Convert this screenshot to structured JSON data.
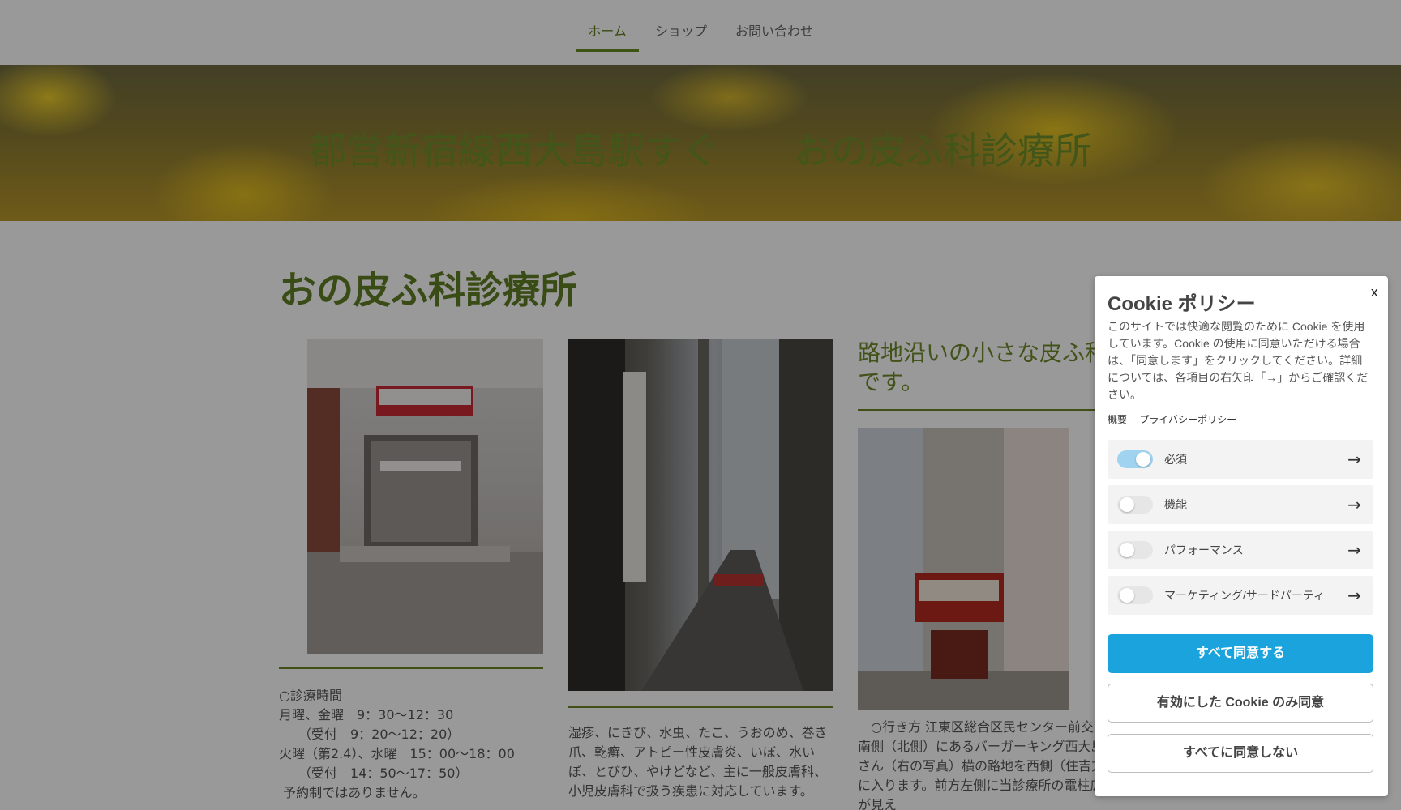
{
  "nav": {
    "items": [
      {
        "label": "ホーム",
        "active": true
      },
      {
        "label": "ショップ",
        "active": false
      },
      {
        "label": "お問い合わせ",
        "active": false
      }
    ]
  },
  "hero": {
    "title": "都営新宿線西大島駅すぐ　　おの皮ふ科診療所"
  },
  "main": {
    "page_title": "おの皮ふ科診療所",
    "tagline": "路地沿いの小さな皮ふ科です。",
    "hours": "○診療時間\n月曜、金曜　9：30～12：30\n　　（受付　9：20～12：20）\n火曜（第2.4）、水曜　15：00～18：00\n　　（受付　14：50～17：50）\n 予約制ではありません。",
    "symptoms": "湿疹、にきび、水虫、たこ、うおのめ、巻き爪、乾癬、アトピー性皮膚炎、いぼ、水いぼ、とびひ、やけどなど、主に一般皮膚科、小児皮膚科で扱う疾患に対応しています。",
    "access": "　○行き方\n江東区総合区民センター前交差点南側（北側）にあるバーガーキング西大島店さん（右の写真）横の路地を西側（住吉方面）に入ります。前方左側に当診療所の電柱広告が見え"
  },
  "cookie": {
    "title": "Cookie ポリシー",
    "close": "x",
    "description": "このサイトでは快適な閲覧のために Cookie を使用しています。Cookie の使用に同意いただける場合は、「同意します」をクリックしてください。詳細については、各項目の右矢印「→」からご確認ください。",
    "links": [
      "概要",
      "プライバシーポリシー"
    ],
    "toggles": [
      {
        "label": "必須",
        "on": true
      },
      {
        "label": "機能",
        "on": false
      },
      {
        "label": "パフォーマンス",
        "on": false
      },
      {
        "label": "マーケティング/サードパーティ",
        "on": false
      }
    ],
    "arrow": "→",
    "buttons": {
      "accept_all": "すべて同意する",
      "accept_enabled": "有効にした Cookie のみ同意",
      "reject_all": "すべてに同意しない"
    }
  },
  "colors": {
    "accent_green": "#6a8426",
    "cookie_primary": "#1aa3dd"
  }
}
